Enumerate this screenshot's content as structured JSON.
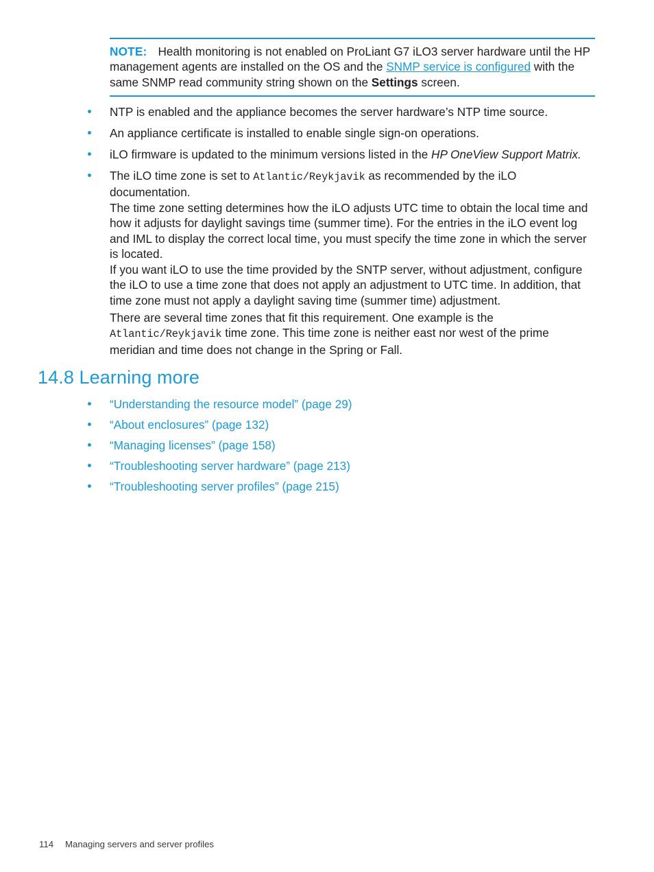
{
  "document": {
    "note": {
      "label": "NOTE:",
      "text_before_link": "Health monitoring is not enabled on ProLiant G7 iLO3 server hardware until the HP management agents are installed on the OS and the ",
      "link_text": "SNMP service is configured",
      "text_after_link": " with the same SNMP read community string shown on the ",
      "bold_term": "Settings",
      "text_end": " screen."
    },
    "requirements_bullets": [
      {
        "parts": [
          {
            "type": "text",
            "value": "NTP is enabled and the appliance becomes the server hardware’s NTP time source."
          }
        ]
      },
      {
        "parts": [
          {
            "type": "text",
            "value": "An appliance certificate is installed to enable single sign-on operations."
          }
        ]
      },
      {
        "parts": [
          {
            "type": "text",
            "value": "iLO firmware is updated to the minimum versions listed in the "
          },
          {
            "type": "italic",
            "value": "HP OneView Support Matrix."
          }
        ]
      },
      {
        "parts": [
          {
            "type": "text",
            "value": "The iLO time zone is set to "
          },
          {
            "type": "mono",
            "value": "Atlantic/Reykjavik"
          },
          {
            "type": "text",
            "value": " as recommended by the iLO documentation."
          }
        ]
      }
    ],
    "paragraphs": [
      {
        "parts": [
          {
            "type": "text",
            "value": "The time zone setting determines how the iLO adjusts UTC time to obtain the local time and how it adjusts for daylight savings time (summer time). For the entries in the iLO event log and IML to display the correct local time, you must specify the time zone in which the server is located."
          }
        ]
      },
      {
        "parts": [
          {
            "type": "text",
            "value": "If you want iLO to use the time provided by the SNTP server, without adjustment, configure the iLO to use a time zone that does not apply an adjustment to UTC time. In addition, that time zone must not apply a daylight saving time (summer time) adjustment."
          }
        ]
      },
      {
        "parts": [
          {
            "type": "text",
            "value": "There are several time zones that fit this requirement. One example is the "
          },
          {
            "type": "mono",
            "value": "Atlantic/Reykjavik"
          },
          {
            "type": "text",
            "value": " time zone. This time zone is neither east nor west of the prime meridian and time does not change in the Spring or Fall."
          }
        ]
      }
    ],
    "section": {
      "number": "14.8",
      "title": "Learning more",
      "heading_full": "14.8 Learning more"
    },
    "learning_more_links": [
      {
        "title": "“Understanding the resource model”",
        "page_ref": "(page 29)",
        "full": "“Understanding the resource model” (page 29)"
      },
      {
        "title": "“About enclosures”",
        "page_ref": "(page 132)",
        "full": "“About enclosures” (page 132)"
      },
      {
        "title": "“Managing licenses”",
        "page_ref": "(page 158)",
        "full": "“Managing licenses” (page 158)"
      },
      {
        "title": "“Troubleshooting server hardware”",
        "page_ref": "(page 213)",
        "full": "“Troubleshooting server hardware” (page 213)"
      },
      {
        "title": "“Troubleshooting server profiles”",
        "page_ref": "(page 215)",
        "full": "“Troubleshooting server profiles” (page 215)"
      }
    ],
    "footer": {
      "page_number": "114",
      "chapter_title": "Managing servers and server profiles"
    },
    "colors": {
      "accent_blue": "#1b9bd8",
      "note_label_blue": "#0e9add",
      "body_text": "#231f20",
      "footer_text": "#3b3b3b",
      "background": "#ffffff"
    }
  }
}
